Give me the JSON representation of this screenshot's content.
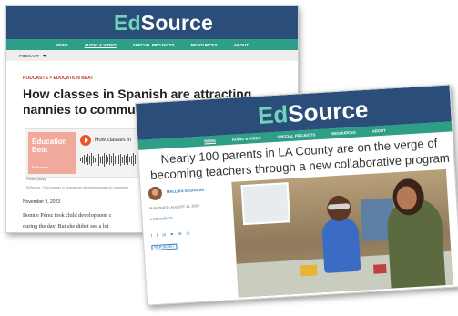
{
  "back": {
    "logo_ed": "Ed",
    "logo_source": "Source",
    "nav": [
      "NEWS",
      "AUDIO & VIDEO",
      "SPECIAL PROJECTS",
      "RESOURCES",
      "ABOUT"
    ],
    "podcast_label": "PODCAST",
    "kicker": "PODCASTS > EDUCATION BEAT",
    "title": "How classes in Spanish are attracting nannies to community college",
    "player": {
      "thumb_title": "Education Beat",
      "thumb_brand": "EdSource",
      "episode_title": "How classes in",
      "privacy": "Privacy policy"
    },
    "caption": "EdSource · How classes in Spanish are attracting nannies to community",
    "date": "November 9, 2023",
    "body_line1": "Bonnie Pérez took child development c",
    "body_line2": "during the day. But she didn't see a lot"
  },
  "front": {
    "logo_ed": "Ed",
    "logo_source": "Source",
    "nav": [
      "NEWS",
      "AUDIO & VIDEO",
      "SPECIAL PROJECTS",
      "RESOURCES",
      "ABOUT"
    ],
    "title": "Nearly 100 parents in LA County are on the verge of becoming teachers through a new collaborative program",
    "author": "MALLIKA SESHADRI",
    "published": "PUBLISHED: AUGUST 16, 2023",
    "comments": "4 COMMENTS",
    "share_icons": [
      "t",
      "f",
      "in",
      "♥",
      "✉",
      "⎙"
    ],
    "republish": "REPUBLISH"
  }
}
